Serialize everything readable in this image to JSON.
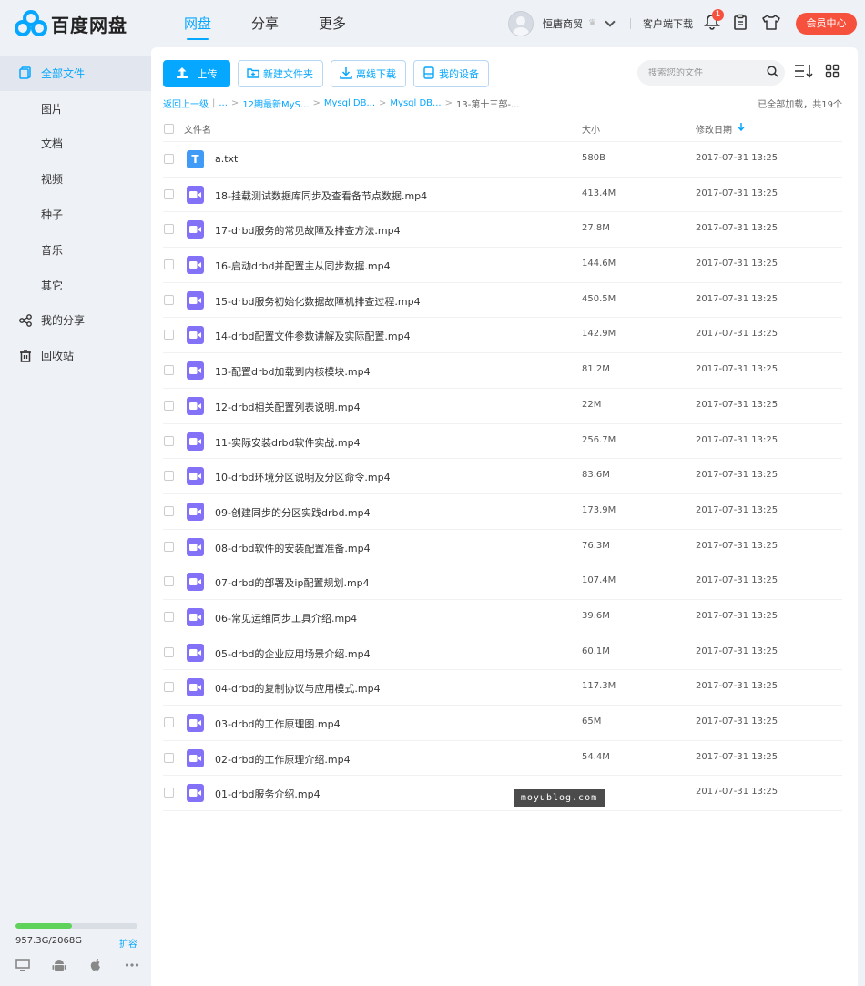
{
  "app": {
    "logo_text": "百度网盘",
    "nav": [
      "网盘",
      "分享",
      "更多"
    ],
    "username": "恒唐商贸",
    "client_download": "客户端下载",
    "notification_count": "1",
    "vip_button": "会员中心",
    "accent_color": "#06a7ff",
    "badge_color": "#f5513d"
  },
  "sidebar": {
    "items": [
      {
        "label": "全部文件",
        "icon": "all-files-icon"
      },
      {
        "label": "图片"
      },
      {
        "label": "文档"
      },
      {
        "label": "视频"
      },
      {
        "label": "种子"
      },
      {
        "label": "音乐"
      },
      {
        "label": "其它"
      },
      {
        "label": "我的分享",
        "icon": "share-icon"
      },
      {
        "label": "回收站",
        "icon": "trash-icon"
      }
    ],
    "storage_text": "957.3G/2068G",
    "storage_used_fraction": 0.463,
    "expand_label": "扩容"
  },
  "toolbar": {
    "upload": "上传",
    "new_folder": "新建文件夹",
    "offline_download": "离线下载",
    "my_devices": "我的设备",
    "search_placeholder": "搜索您的文件"
  },
  "breadcrumb": {
    "back": "返回上一级",
    "items": [
      "...",
      "12期最新MyS...",
      "Mysql DB...",
      "Mysql DB..."
    ],
    "current": "13-第十三部-...",
    "loaded_text": "已全部加载，共19个"
  },
  "table": {
    "headers": {
      "name": "文件名",
      "size": "大小",
      "date": "修改日期"
    },
    "rows": [
      {
        "name": "a.txt",
        "size": "580B",
        "date": "2017-07-31 13:25",
        "type": "txt"
      },
      {
        "name": "18-挂载测试数据库同步及查看备节点数据.mp4",
        "size": "413.4M",
        "date": "2017-07-31 13:25",
        "type": "mp4"
      },
      {
        "name": "17-drbd服务的常见故障及排查方法.mp4",
        "size": "27.8M",
        "date": "2017-07-31 13:25",
        "type": "mp4"
      },
      {
        "name": "16-启动drbd并配置主从同步数据.mp4",
        "size": "144.6M",
        "date": "2017-07-31 13:25",
        "type": "mp4"
      },
      {
        "name": "15-drbd服务初始化数据故障机排查过程.mp4",
        "size": "450.5M",
        "date": "2017-07-31 13:25",
        "type": "mp4"
      },
      {
        "name": "14-drbd配置文件参数讲解及实际配置.mp4",
        "size": "142.9M",
        "date": "2017-07-31 13:25",
        "type": "mp4"
      },
      {
        "name": "13-配置drbd加载到内核模块.mp4",
        "size": "81.2M",
        "date": "2017-07-31 13:25",
        "type": "mp4"
      },
      {
        "name": "12-drbd相关配置列表说明.mp4",
        "size": "22M",
        "date": "2017-07-31 13:25",
        "type": "mp4"
      },
      {
        "name": "11-实际安装drbd软件实战.mp4",
        "size": "256.7M",
        "date": "2017-07-31 13:25",
        "type": "mp4"
      },
      {
        "name": "10-drbd环境分区说明及分区命令.mp4",
        "size": "83.6M",
        "date": "2017-07-31 13:25",
        "type": "mp4"
      },
      {
        "name": "09-创建同步的分区实践drbd.mp4",
        "size": "173.9M",
        "date": "2017-07-31 13:25",
        "type": "mp4"
      },
      {
        "name": "08-drbd软件的安装配置准备.mp4",
        "size": "76.3M",
        "date": "2017-07-31 13:25",
        "type": "mp4"
      },
      {
        "name": "07-drbd的部署及ip配置规划.mp4",
        "size": "107.4M",
        "date": "2017-07-31 13:25",
        "type": "mp4"
      },
      {
        "name": "06-常见运维同步工具介绍.mp4",
        "size": "39.6M",
        "date": "2017-07-31 13:25",
        "type": "mp4"
      },
      {
        "name": "05-drbd的企业应用场景介绍.mp4",
        "size": "60.1M",
        "date": "2017-07-31 13:25",
        "type": "mp4"
      },
      {
        "name": "04-drbd的复制协议与应用模式.mp4",
        "size": "117.3M",
        "date": "2017-07-31 13:25",
        "type": "mp4"
      },
      {
        "name": "03-drbd的工作原理图.mp4",
        "size": "65M",
        "date": "2017-07-31 13:25",
        "type": "mp4"
      },
      {
        "name": "02-drbd的工作原理介绍.mp4",
        "size": "54.4M",
        "date": "2017-07-31 13:25",
        "type": "mp4"
      },
      {
        "name": "01-drbd服务介绍.mp4",
        "size": "",
        "date": "2017-07-31 13:25",
        "type": "mp4"
      }
    ]
  },
  "watermark": "moyublog.com"
}
